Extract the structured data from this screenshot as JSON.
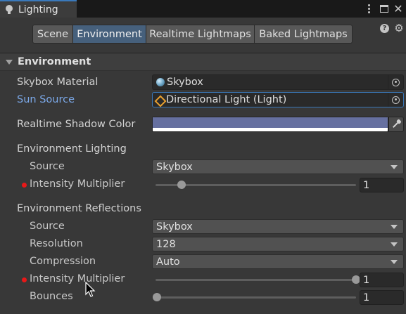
{
  "window": {
    "tab_title": "Lighting"
  },
  "subtabs": [
    "Scene",
    "Environment",
    "Realtime Lightmaps",
    "Baked Lightmaps"
  ],
  "active_subtab": "Environment",
  "section": {
    "title": "Environment"
  },
  "fields": {
    "skybox_material": {
      "label": "Skybox Material",
      "value": "Skybox"
    },
    "sun_source": {
      "label": "Sun Source",
      "value": "Directional Light (Light)"
    },
    "shadow_color": {
      "label": "Realtime Shadow Color",
      "color": "#6670a0"
    }
  },
  "environment_lighting": {
    "header": "Environment Lighting",
    "source_label": "Source",
    "source_value": "Skybox",
    "intensity_label": "Intensity Multiplier",
    "intensity_value": "1",
    "intensity_fraction": 0.125
  },
  "environment_reflections": {
    "header": "Environment Reflections",
    "source_label": "Source",
    "source_value": "Skybox",
    "resolution_label": "Resolution",
    "resolution_value": "128",
    "compression_label": "Compression",
    "compression_value": "Auto",
    "intensity_label": "Intensity Multiplier",
    "intensity_value": "1",
    "intensity_fraction": 1.0,
    "bounces_label": "Bounces",
    "bounces_value": "1",
    "bounces_fraction": 0.0
  },
  "colors": {
    "accent_blue": "#3a79bb",
    "active_tab": "#46607c",
    "override_dot": "#e81818",
    "link_label": "#7ba8e8"
  },
  "icons": {
    "tab": "lightbulb-icon",
    "help": "help-icon",
    "settings": "gear-icon",
    "skybox": "sphere-icon",
    "sun": "directional-light-icon",
    "picker": "object-picker-icon",
    "eyedropper": "eyedropper-icon"
  }
}
